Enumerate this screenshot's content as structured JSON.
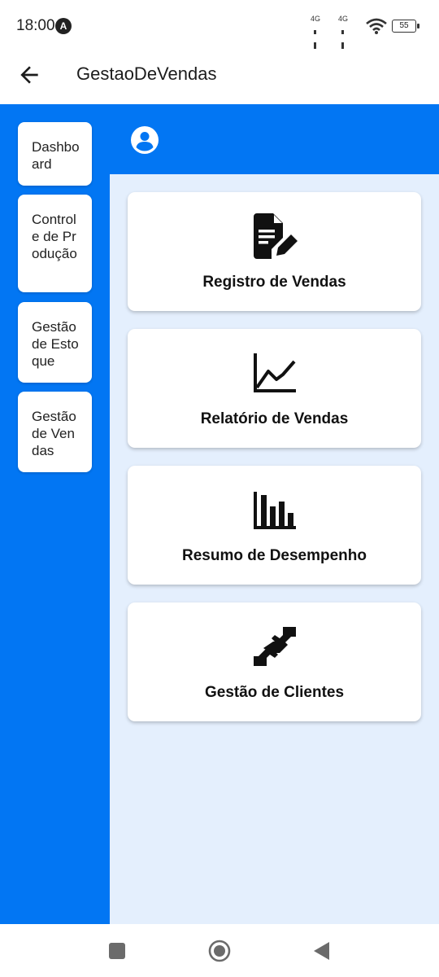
{
  "status": {
    "time": "18:00",
    "notif_badge": "A",
    "net1": "4G",
    "net2": "4G",
    "battery": "55"
  },
  "appbar": {
    "title": "GestaoDeVendas",
    "back_icon": "arrow-left-icon"
  },
  "sidebar": {
    "items": [
      {
        "label": "Dashboard"
      },
      {
        "label": "Controle de Produção"
      },
      {
        "label": "Gestão de Estoque"
      },
      {
        "label": "Gestão de Vendas"
      }
    ]
  },
  "header": {
    "user_icon": "account-circle-icon"
  },
  "cards": [
    {
      "label": "Registro de Vendas",
      "icon": "file-edit-icon"
    },
    {
      "label": "Relatório de Vendas",
      "icon": "line-chart-icon"
    },
    {
      "label": "Resumo de Desempenho",
      "icon": "bar-chart-icon"
    },
    {
      "label": "Gestão de Clientes",
      "icon": "handshake-icon"
    }
  ],
  "colors": {
    "primary": "#0276f3",
    "content_bg": "#e4effd"
  }
}
